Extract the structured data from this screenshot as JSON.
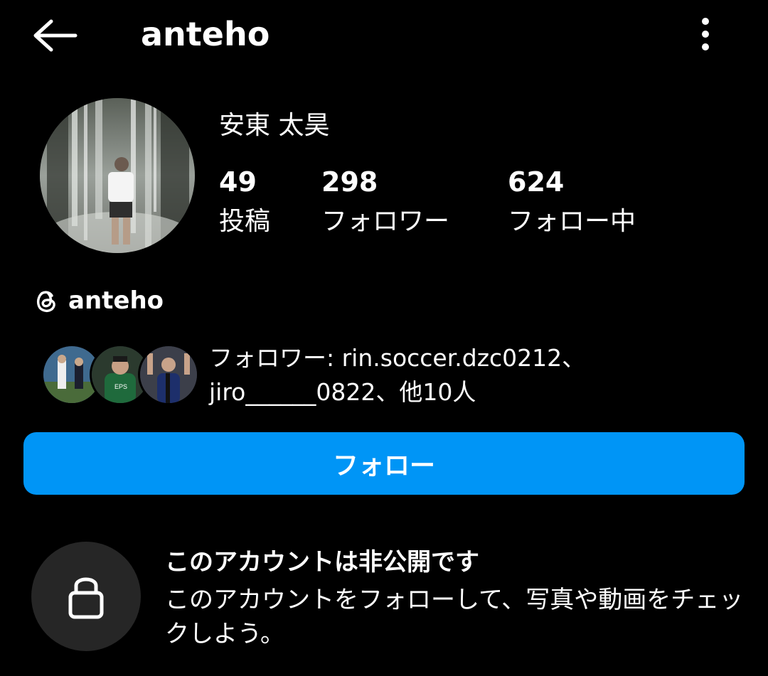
{
  "header": {
    "title": "anteho",
    "back_icon": "arrow-left-icon",
    "more_icon": "more-vertical-icon"
  },
  "profile": {
    "full_name": "安東 太昊",
    "stats": {
      "posts": {
        "count": "49",
        "label": "投稿"
      },
      "followers": {
        "count": "298",
        "label": "フォロワー"
      },
      "following": {
        "count": "624",
        "label": "フォロー中"
      }
    }
  },
  "threads": {
    "icon": "threads-icon",
    "handle": "anteho"
  },
  "mutual_followers": {
    "text_line1": "フォロワー: rin.soccer.dzc0212、",
    "text_line2": "jiro______0822、他10人"
  },
  "follow_button": {
    "label": "フォロー",
    "color": "#0095f6"
  },
  "private_notice": {
    "icon": "lock-icon",
    "title": "このアカウントは非公開です",
    "description": "このアカウントをフォローして、写真や動画をチェックしよう。"
  }
}
